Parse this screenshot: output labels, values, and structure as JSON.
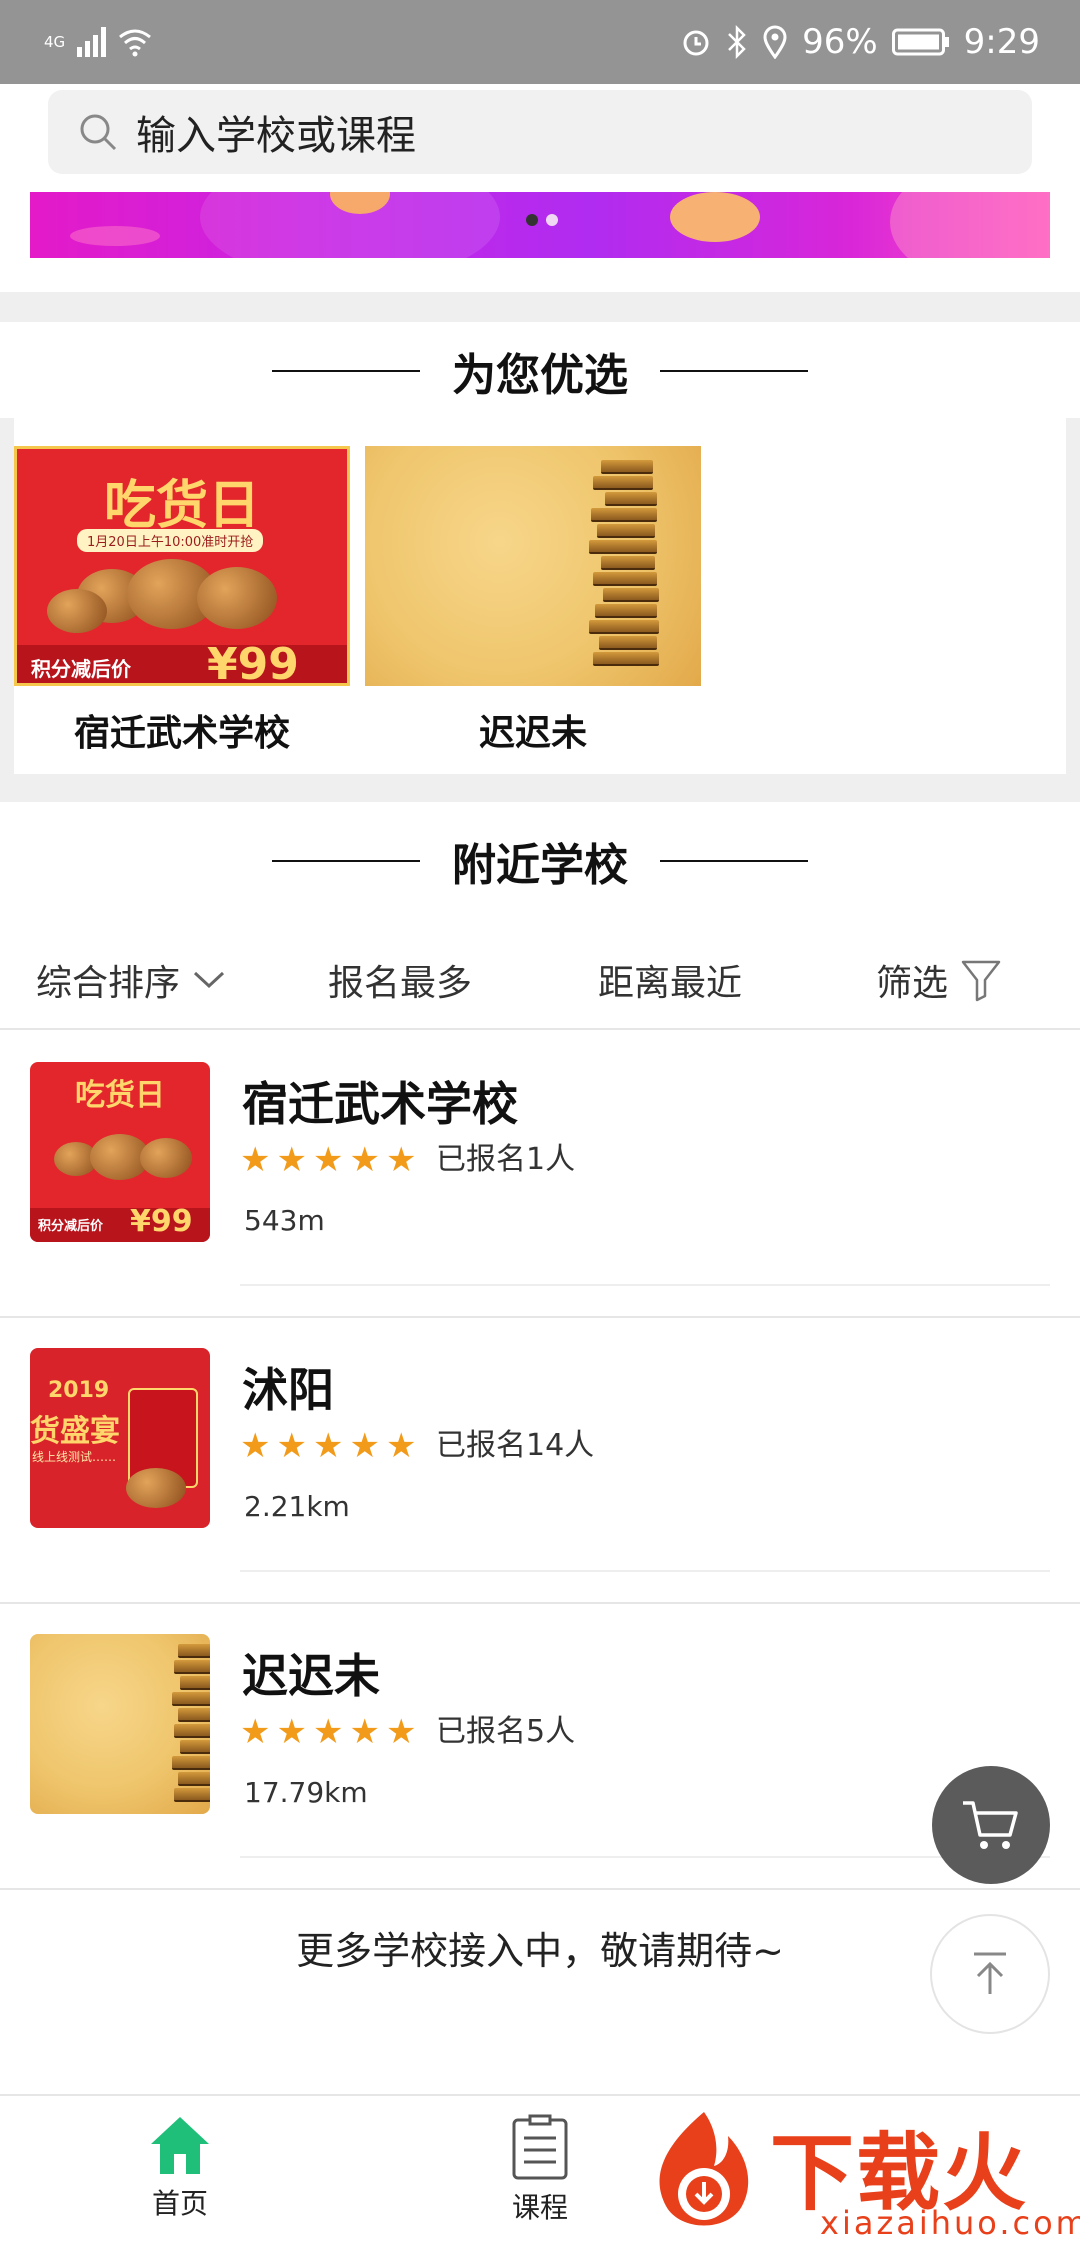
{
  "status_bar": {
    "network": "4G",
    "battery": "96%",
    "time": "9:29"
  },
  "search": {
    "placeholder": "输入学校或课程"
  },
  "banner": {
    "page_count": 2,
    "active_index": 0
  },
  "recommend": {
    "title": "为您优选",
    "cards": [
      {
        "name": "宿迁武术学校"
      },
      {
        "name": "迟迟未"
      }
    ]
  },
  "nearby": {
    "title": "附近学校",
    "filters": {
      "sort": "综合排序",
      "most_enrolled": "报名最多",
      "nearest": "距离最近",
      "filter": "筛选"
    },
    "schools": [
      {
        "name": "宿迁武术学校",
        "rating": 5,
        "enrolled": "已报名1人",
        "distance": "543m"
      },
      {
        "name": "沭阳",
        "rating": 5,
        "enrolled": "已报名14人",
        "distance": "2.21km"
      },
      {
        "name": "迟迟未",
        "rating": 5,
        "enrolled": "已报名5人",
        "distance": "17.79km"
      }
    ],
    "footer": "更多学校接入中，敬请期待~"
  },
  "promo_image": {
    "headline": "吃货日",
    "date_line": "1月20日上午10:00准时开抢",
    "price_label": "积分减后价",
    "price": "¥99"
  },
  "promo_image_2": {
    "year": "2019",
    "headline": "货盛宴",
    "sub": "线上线测试……"
  },
  "tabs": [
    {
      "label": "首页",
      "icon": "home-icon",
      "active": true
    },
    {
      "label": "课程",
      "icon": "course-icon",
      "active": false
    }
  ],
  "watermark": {
    "brand": "下载火",
    "domain": "xiazaihuo.com"
  },
  "colors": {
    "accent": "#1fbf7a",
    "star": "#f29b1a",
    "banner": "#c625e6",
    "watermark": "#e8401a"
  }
}
